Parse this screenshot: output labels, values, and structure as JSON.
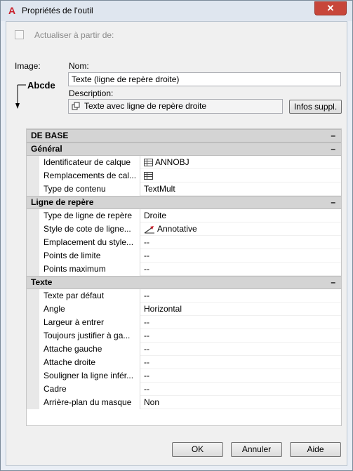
{
  "window": {
    "title": "Propriétés de l'outil",
    "close_glyph": "✕"
  },
  "update_from": {
    "label": "Actualiser à partir de:",
    "checked": false
  },
  "image": {
    "label": "Image:",
    "preview_text": "Abcde"
  },
  "name": {
    "label": "Nom:",
    "value": "Texte (ligne de repère droite)"
  },
  "description": {
    "label": "Description:",
    "value": "Texte avec ligne de repère droite"
  },
  "infos_button": "Infos suppl.",
  "properties": {
    "root": "DE BASE",
    "sections": [
      {
        "title": "Général",
        "rows": [
          {
            "name": "Identificateur de calque",
            "value": "ANNOBJ",
            "icon": "layer-icon"
          },
          {
            "name": "Remplacements de cal...",
            "value": "",
            "icon": "layer-icon"
          },
          {
            "name": "Type de contenu",
            "value": "TextMult"
          }
        ]
      },
      {
        "title": "Ligne de repère",
        "rows": [
          {
            "name": "Type de ligne de repère",
            "value": "Droite"
          },
          {
            "name": "Style de cote de ligne...",
            "value": "Annotative",
            "icon": "annotative-style-icon"
          },
          {
            "name": "Emplacement du style...",
            "value": "--"
          },
          {
            "name": "Points de limite",
            "value": "--"
          },
          {
            "name": "Points maximum",
            "value": "--"
          }
        ]
      },
      {
        "title": "Texte",
        "rows": [
          {
            "name": "Texte par défaut",
            "value": "--"
          },
          {
            "name": "Angle",
            "value": "Horizontal"
          },
          {
            "name": "Largeur à entrer",
            "value": "--"
          },
          {
            "name": "Toujours justifier à ga...",
            "value": "--"
          },
          {
            "name": "Attache gauche",
            "value": "--"
          },
          {
            "name": "Attache droite",
            "value": "--"
          },
          {
            "name": "Souligner la ligne infér...",
            "value": "--"
          },
          {
            "name": "Cadre",
            "value": "--"
          },
          {
            "name": "Arrière-plan du masque",
            "value": "Non"
          }
        ]
      }
    ],
    "collapse_glyph": "–"
  },
  "buttons": {
    "ok": "OK",
    "cancel": "Annuler",
    "help": "Aide"
  },
  "colors": {
    "accent_close": "#c7463a",
    "section_bg": "#d4d4d4"
  }
}
